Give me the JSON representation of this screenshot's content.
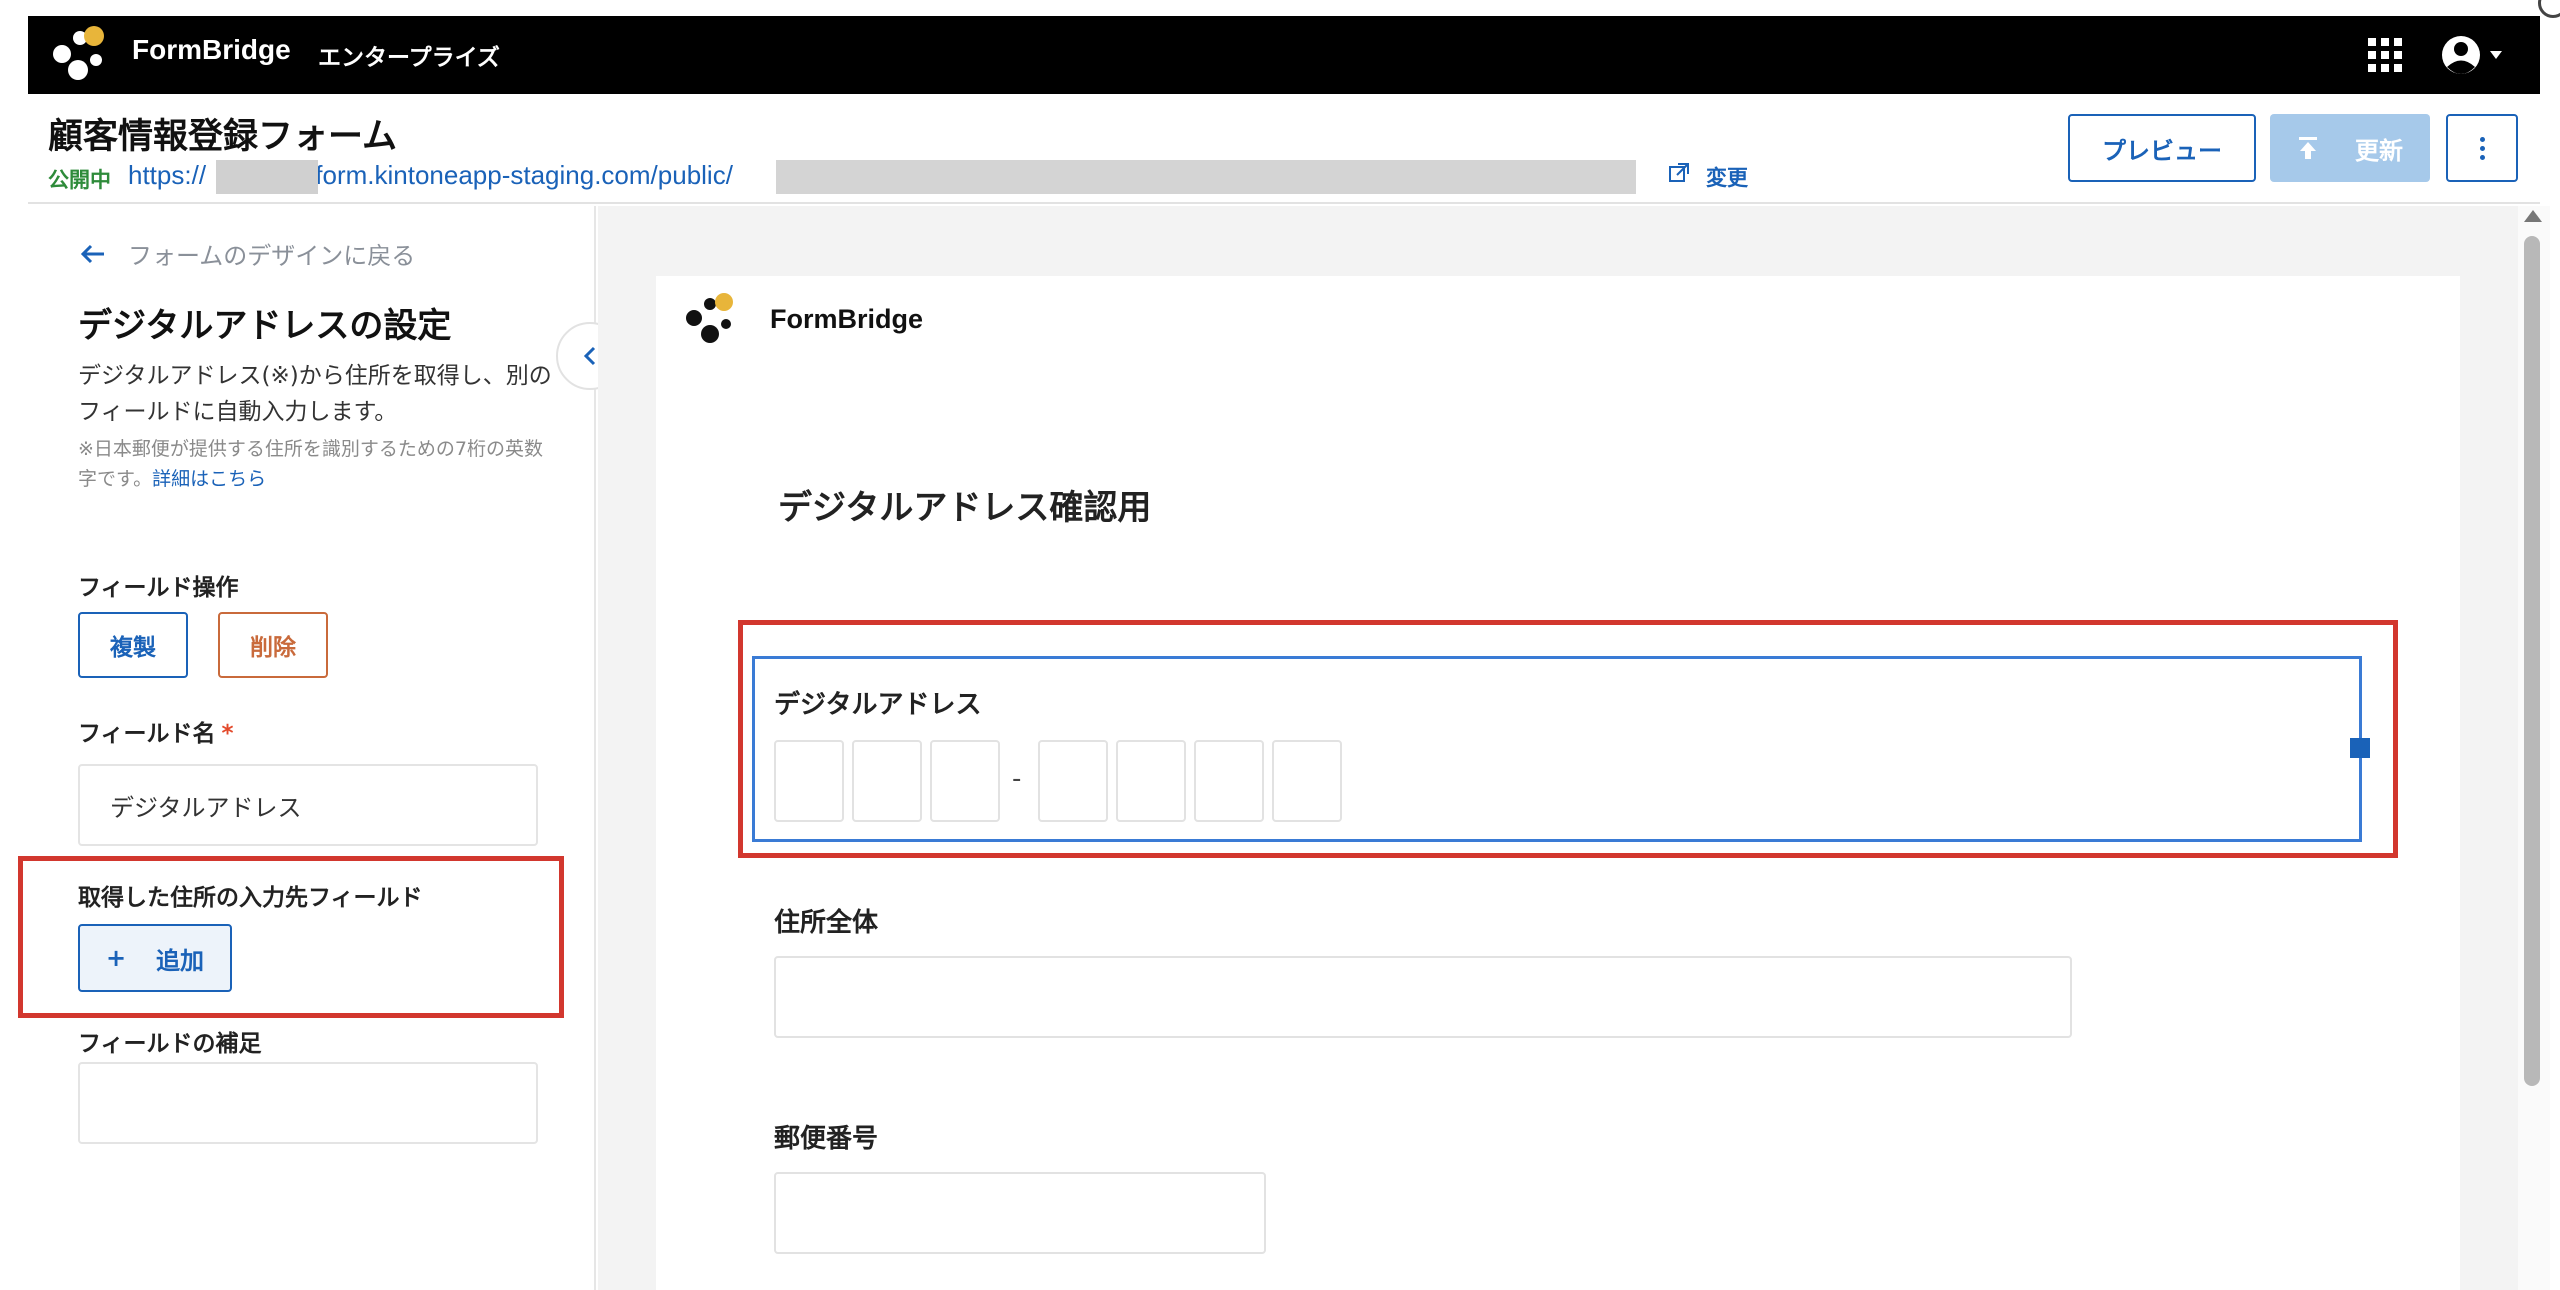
{
  "topbar": {
    "brand": "FormBridge",
    "edition": "エンタープライズ"
  },
  "header": {
    "form_title": "顧客情報登録フォーム",
    "status": "公開中",
    "url": "https://■■■■■.form.kintoneapp-staging.com/public/■■■■",
    "url_prefix": "https://",
    "url_middle": ".form.kintoneapp-staging.com/public/",
    "change_label": "変更",
    "preview_label": "プレビュー",
    "update_label": "更新"
  },
  "left_panel": {
    "back_label": "フォームのデザインに戻る",
    "title": "デジタルアドレスの設定",
    "description": "デジタルアドレス(※)から住所を取得し、別のフィールドに自動入力します。",
    "note": "※日本郵便が提供する住所を識別するための7桁の英数字です。",
    "note_link": "詳細はこちら",
    "field_ops_label": "フィールド操作",
    "copy_label": "複製",
    "delete_label": "削除",
    "field_name_label": "フィールド名",
    "required_mark": "*",
    "field_name_value": "デジタルアドレス",
    "target_field_label": "取得した住所の入力先フィールド",
    "add_icon": "+",
    "add_label": "追加",
    "supplement_label": "フィールドの補足",
    "supplement_value": ""
  },
  "canvas": {
    "brand": "FormBridge",
    "heading": "デジタルアドレス確認用",
    "digital_address_label": "デジタルアドレス",
    "digit_separator": "-",
    "full_address_label": "住所全体",
    "postal_code_label": "郵便番号"
  },
  "colors": {
    "accent": "#1a62b8",
    "highlight": "#d2372e",
    "status_green": "#2e8b3a",
    "delete": "#c96a3b"
  }
}
